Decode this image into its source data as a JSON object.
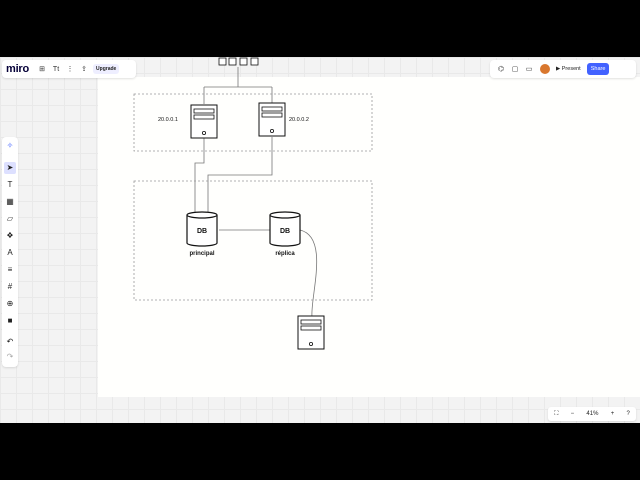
{
  "app": {
    "logo": "miro"
  },
  "toolbar_left": {
    "board_icon": "⊞",
    "name_icon": "Tt",
    "menu_icon": "⋮",
    "export_icon": "⇪",
    "upgrade_label": "Upgrade"
  },
  "toolbar_right": {
    "reactions_icon": "⌬",
    "comment_icon": "▢",
    "video_icon": "▭",
    "present_label": "▶ Present",
    "share_label": "Share"
  },
  "tools": [
    "✧",
    "➤",
    "T",
    "▦",
    "▱",
    "❖",
    "A",
    "≡",
    "#",
    "⊕",
    "■",
    "↶",
    "↷"
  ],
  "zoom": {
    "fit_icon": "⛶",
    "minus": "−",
    "level": "41%",
    "plus": "+",
    "help": "?"
  },
  "diagram": {
    "ip_left": "20.0.0.1",
    "ip_right": "20.0.0.2",
    "db_primary_text": "DB",
    "db_primary_label": "principal",
    "db_replica_text": "DB",
    "db_replica_label": "réplica"
  },
  "colors": {
    "accent": "#4262ff",
    "stroke": "#111111"
  }
}
